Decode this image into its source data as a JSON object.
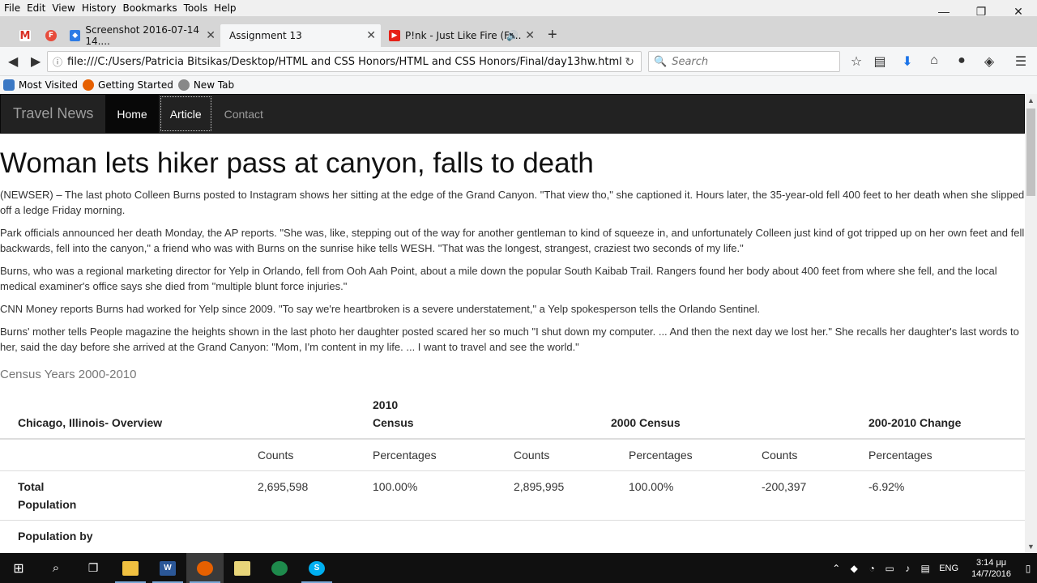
{
  "menubar": {
    "items": [
      "File",
      "Edit",
      "View",
      "History",
      "Bookmarks",
      "Tools",
      "Help"
    ]
  },
  "window_controls": {
    "minimize": "—",
    "restore": "❐",
    "close": "✕"
  },
  "tabs": [
    {
      "label": "",
      "icon": "gmail-icon"
    },
    {
      "label": "",
      "icon": "firefox-f-icon"
    },
    {
      "label": "Screenshot 2016-07-14 14....",
      "icon": "dropbox-icon"
    },
    {
      "label": "Assignment 13",
      "icon": ""
    },
    {
      "label": "P!nk - Just Like Fire (Fr...",
      "icon": "youtube-icon"
    }
  ],
  "toolbar": {
    "url": "file:///C:/Users/Patricia Bitsikas/Desktop/HTML and CSS Honors/HTML and CSS Honors/Final/day13hw.html",
    "search_placeholder": "Search"
  },
  "bookmarks": [
    {
      "label": "Most Visited",
      "icon": "most-visited-icon"
    },
    {
      "label": "Getting Started",
      "icon": "firefox-icon"
    },
    {
      "label": "New Tab",
      "icon": "globe-icon"
    }
  ],
  "site": {
    "brand": "Travel News",
    "nav": [
      "Home",
      "Article",
      "Contact"
    ]
  },
  "article": {
    "headline": "Woman lets hiker pass at canyon, falls to death",
    "paragraphs": [
      "(NEWSER) – The last photo Colleen Burns posted to Instagram shows her sitting at the edge of the Grand Canyon. \"That view tho,\" she captioned it. Hours later, the 35-year-old fell 400 feet to her death when she slipped off a ledge Friday morning.",
      "Park officials announced her death Monday, the AP reports. \"She was, like, stepping out of the way for another gentleman to kind of squeeze in, and unfortunately Colleen just kind of got tripped up on her own feet and fell backwards, fell into the canyon,\" a friend who was with Burns on the sunrise hike tells WESH. \"That was the longest, strangest, craziest two seconds of my life.\"",
      "Burns, who was a regional marketing director for Yelp in Orlando, fell from Ooh Aah Point, about a mile down the popular South Kaibab Trail. Rangers found her body about 400 feet from where she fell, and the local medical examiner's office says she died from \"multiple blunt force injuries.\"",
      "CNN Money reports Burns had worked for Yelp since 2009. \"To say we're heartbroken is a severe understatement,\" a Yelp spokesperson tells the Orlando Sentinel.",
      "Burns' mother tells People magazine the heights shown in the last photo her daughter posted scared her so much \"I shut down my computer. ... And then the next day we lost her.\" She recalls her daughter's last words to her, said the day before she arrived at the Grand Canyon: \"Mom, I'm content in my life. ... I want to travel and see the world.\""
    ]
  },
  "census": {
    "caption": "Census Years 2000-2010",
    "headers": [
      "Chicago, Illinois- Overview",
      "",
      "2010 Census",
      "",
      "2000 Census",
      "",
      "200-2010 Change"
    ],
    "subheaders": [
      "",
      "Counts",
      "Percentages",
      "Counts",
      "Percentages",
      "Counts",
      "Percentages"
    ],
    "rows": [
      [
        "Total Population",
        "2,695,598",
        "100.00%",
        "2,895,995",
        "100.00%",
        "-200,397",
        "-6.92%"
      ],
      [
        "Population by",
        "",
        "",
        "",
        "",
        "",
        ""
      ]
    ]
  },
  "taskbar": {
    "apps": [
      "start-icon",
      "search-icon",
      "task-view-icon",
      "file-explorer-icon",
      "word-icon",
      "firefox-icon",
      "folder-icon",
      "xbox-icon",
      "skype-icon"
    ],
    "language": "ENG",
    "time": "3:14 μμ",
    "date": "14/7/2016"
  }
}
